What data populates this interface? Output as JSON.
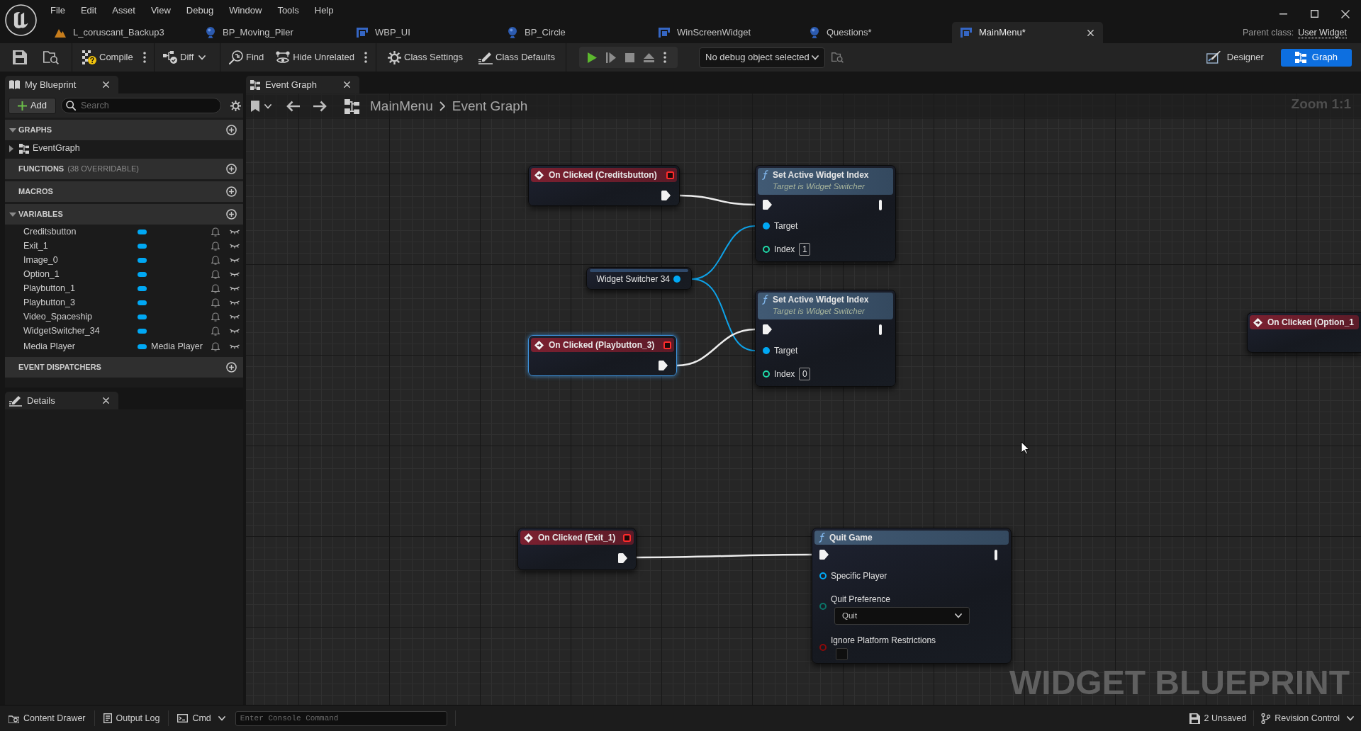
{
  "menu": [
    "File",
    "Edit",
    "Asset",
    "View",
    "Debug",
    "Window",
    "Tools",
    "Help"
  ],
  "document_tabs": [
    {
      "label": "L_coruscant_Backup3",
      "kind": "level",
      "selected": false
    },
    {
      "label": "BP_Moving_Piler",
      "kind": "actor",
      "selected": false
    },
    {
      "label": "WBP_UI",
      "kind": "widget",
      "selected": false
    },
    {
      "label": "BP_Circle",
      "kind": "actor",
      "selected": false
    },
    {
      "label": "WinScreenWidget",
      "kind": "widget",
      "selected": false
    },
    {
      "label": "Questions*",
      "kind": "actor",
      "selected": false
    },
    {
      "label": "MainMenu*",
      "kind": "widget",
      "selected": true
    }
  ],
  "parent_class": {
    "label": "Parent class:",
    "value": "User Widget"
  },
  "toolbar": {
    "buttons": [
      {
        "label": "Compile",
        "kind": "split"
      },
      {
        "label": "Diff",
        "kind": "dropdown"
      },
      {
        "label": "Find",
        "kind": "plain"
      },
      {
        "label": "Hide Unrelated",
        "kind": "split"
      },
      {
        "label": "Class Settings",
        "kind": "plain"
      },
      {
        "label": "Class Defaults",
        "kind": "plain"
      }
    ],
    "debug_object": {
      "value": "No debug object selected"
    },
    "modes": [
      {
        "label": "Designer",
        "selected": false
      },
      {
        "label": "Graph",
        "selected": true
      }
    ]
  },
  "my_blueprint": {
    "tab": {
      "label": "My Blueprint"
    },
    "add_button": {
      "label": "Add"
    },
    "search": {
      "placeholder": "Search"
    },
    "sections": [
      {
        "title": "GRAPHS",
        "expanded": true,
        "items": [
          {
            "name": "EventGraph",
            "expanded": false
          }
        ]
      },
      {
        "title": "FUNCTIONS",
        "note": "(38 OVERRIDABLE)"
      },
      {
        "title": "MACROS"
      },
      {
        "title": "VARIABLES",
        "expanded": true,
        "variables": [
          {
            "name": "Creditsbutton"
          },
          {
            "name": "Exit_1"
          },
          {
            "name": "Image_0"
          },
          {
            "name": "Option_1"
          },
          {
            "name": "Playbutton_1"
          },
          {
            "name": "Playbutton_3"
          },
          {
            "name": "Video_Spaceship"
          },
          {
            "name": "WidgetSwitcher_34"
          },
          {
            "name": "Media Player",
            "type": "Media Player"
          }
        ]
      },
      {
        "title": "EVENT DISPATCHERS"
      }
    ]
  },
  "details": {
    "tab": {
      "label": "Details"
    }
  },
  "graph": {
    "tab": {
      "label": "Event Graph"
    },
    "breadcrumb": [
      "MainMenu",
      "Event Graph"
    ],
    "zoom_label": "Zoom 1:1",
    "watermark": "WIDGET BLUEPRINT",
    "nodes": [
      {
        "kind": "event",
        "title": "On Clicked (Creditsbutton)",
        "selected": false,
        "delegate_pin": true,
        "exec_out": {
          "connected": true
        }
      },
      {
        "kind": "function",
        "title": "Set Active Widget Index",
        "subtitle": "Target is Widget Switcher",
        "selected": false,
        "exec_in": {
          "connected": true
        },
        "exec_out": {
          "connected": false
        },
        "pins": [
          {
            "label": "Target",
            "color": "#00a8f4",
            "connected": true
          },
          {
            "label": "Index",
            "color": "#1fd9a8",
            "connected": false,
            "input": {
              "kind": "number",
              "value": "1"
            }
          }
        ]
      },
      {
        "kind": "variable",
        "title": "Widget Switcher 34",
        "selected": false,
        "pin": {
          "color": "#00a8f4",
          "connected": true
        }
      },
      {
        "kind": "function",
        "title": "Set Active Widget Index",
        "subtitle": "Target is Widget Switcher",
        "selected": false,
        "exec_in": {
          "connected": true
        },
        "exec_out": {
          "connected": false
        },
        "pins": [
          {
            "label": "Target",
            "color": "#00a8f4",
            "connected": true
          },
          {
            "label": "Index",
            "color": "#1fd9a8",
            "connected": false,
            "input": {
              "kind": "number",
              "value": "0"
            }
          }
        ]
      },
      {
        "kind": "event",
        "title": "On Clicked (Playbutton_3)",
        "selected": true,
        "delegate_pin": true,
        "exec_out": {
          "connected": true
        }
      },
      {
        "kind": "event",
        "title": "On Clicked (Option_1",
        "selected": false
      },
      {
        "kind": "event",
        "title": "On Clicked (Exit_1)",
        "selected": false,
        "delegate_pin": true,
        "exec_out": {
          "connected": true
        }
      },
      {
        "kind": "function",
        "title": "Quit Game",
        "selected": false,
        "exec_in": {
          "connected": true
        },
        "exec_out": {
          "connected": false
        },
        "pins": [
          {
            "label": "Specific Player",
            "color": "#00a8f4",
            "connected": false
          },
          {
            "label": "Quit Preference",
            "color": "#0b7368",
            "connected": false,
            "input": {
              "kind": "dropdown",
              "value": "Quit"
            }
          },
          {
            "label": "Ignore Platform Restrictions",
            "color": "#8c0a0a",
            "connected": false,
            "input": {
              "kind": "checkbox",
              "checked": false
            }
          }
        ]
      }
    ]
  },
  "status_bar": {
    "left": [
      {
        "label": "Content Drawer",
        "kind": "plain"
      },
      {
        "label": "Output Log",
        "kind": "plain"
      },
      {
        "label": "Cmd",
        "kind": "dropdown"
      }
    ],
    "console": {
      "placeholder": "Enter Console Command"
    },
    "right": [
      {
        "label": "2 Unsaved",
        "kind": "plain"
      },
      {
        "label": "Revision Control",
        "kind": "dropdown"
      }
    ]
  }
}
